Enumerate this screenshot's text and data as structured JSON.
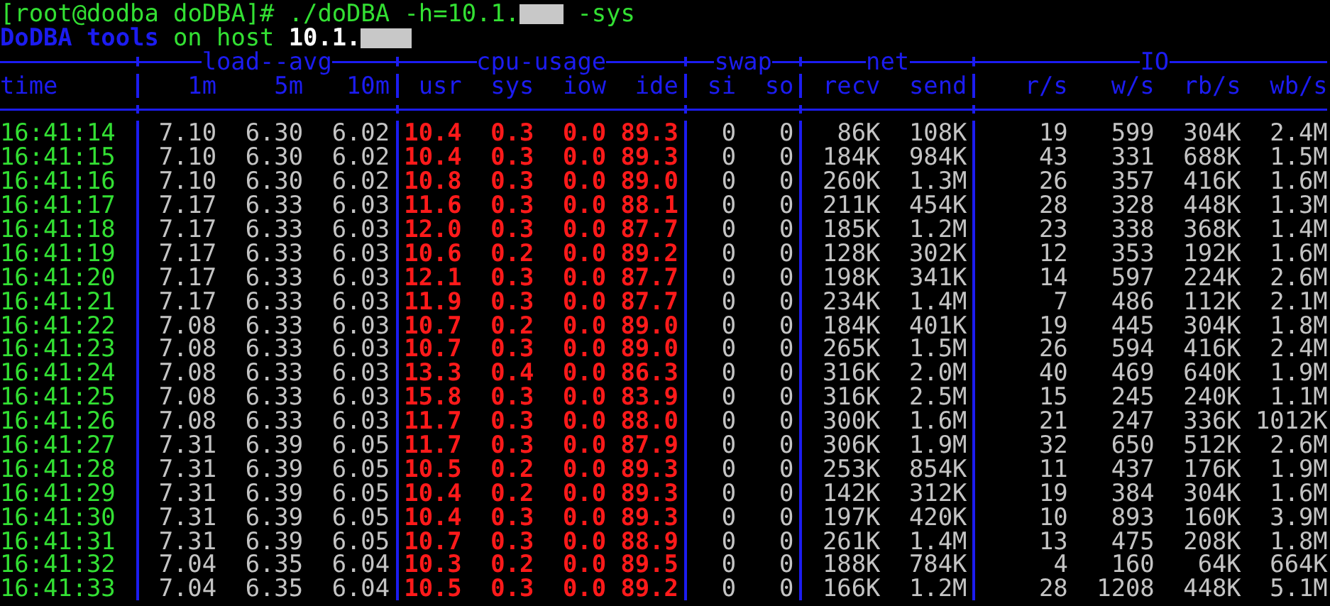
{
  "prompt_line": {
    "prompt": "[root@dodba doDBA]#",
    "command": "./doDBA -h=10.1.",
    "option": "-sys"
  },
  "banner": {
    "tool": "DoDBA tools",
    "text": "on host",
    "host": "10.1."
  },
  "groups": [
    {
      "title": "load--avg"
    },
    {
      "title": "cpu-usage"
    },
    {
      "title": "swap"
    },
    {
      "title": "net"
    },
    {
      "title": "IO"
    }
  ],
  "columns": [
    "time",
    "1m",
    "5m",
    "10m",
    "usr",
    "sys",
    "iow",
    "ide",
    "si",
    "so",
    "recv",
    "send",
    "r/s",
    "w/s",
    "rb/s",
    "wb/s"
  ],
  "rows": [
    {
      "time": "16:41:14",
      "values": [
        "7.10",
        "6.30",
        "6.02",
        "10.4",
        "0.3",
        "0.0",
        "89.3",
        "0",
        "0",
        "86K",
        "108K",
        "19",
        "599",
        "304K",
        "2.4M"
      ]
    },
    {
      "time": "16:41:15",
      "values": [
        "7.10",
        "6.30",
        "6.02",
        "10.4",
        "0.3",
        "0.0",
        "89.3",
        "0",
        "0",
        "184K",
        "984K",
        "43",
        "331",
        "688K",
        "1.5M"
      ]
    },
    {
      "time": "16:41:16",
      "values": [
        "7.10",
        "6.30",
        "6.02",
        "10.8",
        "0.3",
        "0.0",
        "89.0",
        "0",
        "0",
        "260K",
        "1.3M",
        "26",
        "357",
        "416K",
        "1.6M"
      ]
    },
    {
      "time": "16:41:17",
      "values": [
        "7.17",
        "6.33",
        "6.03",
        "11.6",
        "0.3",
        "0.0",
        "88.1",
        "0",
        "0",
        "211K",
        "454K",
        "28",
        "328",
        "448K",
        "1.3M"
      ]
    },
    {
      "time": "16:41:18",
      "values": [
        "7.17",
        "6.33",
        "6.03",
        "12.0",
        "0.3",
        "0.0",
        "87.7",
        "0",
        "0",
        "185K",
        "1.2M",
        "23",
        "338",
        "368K",
        "1.4M"
      ]
    },
    {
      "time": "16:41:19",
      "values": [
        "7.17",
        "6.33",
        "6.03",
        "10.6",
        "0.2",
        "0.0",
        "89.2",
        "0",
        "0",
        "128K",
        "302K",
        "12",
        "353",
        "192K",
        "1.6M"
      ]
    },
    {
      "time": "16:41:20",
      "values": [
        "7.17",
        "6.33",
        "6.03",
        "12.1",
        "0.3",
        "0.0",
        "87.7",
        "0",
        "0",
        "198K",
        "341K",
        "14",
        "597",
        "224K",
        "2.6M"
      ]
    },
    {
      "time": "16:41:21",
      "values": [
        "7.17",
        "6.33",
        "6.03",
        "11.9",
        "0.3",
        "0.0",
        "87.7",
        "0",
        "0",
        "234K",
        "1.4M",
        "7",
        "486",
        "112K",
        "2.1M"
      ]
    },
    {
      "time": "16:41:22",
      "values": [
        "7.08",
        "6.33",
        "6.03",
        "10.7",
        "0.2",
        "0.0",
        "89.0",
        "0",
        "0",
        "184K",
        "401K",
        "19",
        "445",
        "304K",
        "1.8M"
      ]
    },
    {
      "time": "16:41:23",
      "values": [
        "7.08",
        "6.33",
        "6.03",
        "10.7",
        "0.3",
        "0.0",
        "89.0",
        "0",
        "0",
        "265K",
        "1.5M",
        "26",
        "594",
        "416K",
        "2.4M"
      ]
    },
    {
      "time": "16:41:24",
      "values": [
        "7.08",
        "6.33",
        "6.03",
        "13.3",
        "0.4",
        "0.0",
        "86.3",
        "0",
        "0",
        "316K",
        "2.0M",
        "40",
        "469",
        "640K",
        "1.9M"
      ]
    },
    {
      "time": "16:41:25",
      "values": [
        "7.08",
        "6.33",
        "6.03",
        "15.8",
        "0.3",
        "0.0",
        "83.9",
        "0",
        "0",
        "316K",
        "2.5M",
        "15",
        "245",
        "240K",
        "1.1M"
      ]
    },
    {
      "time": "16:41:26",
      "values": [
        "7.08",
        "6.33",
        "6.03",
        "11.7",
        "0.3",
        "0.0",
        "88.0",
        "0",
        "0",
        "300K",
        "1.6M",
        "21",
        "247",
        "336K",
        "1012K"
      ]
    },
    {
      "time": "16:41:27",
      "values": [
        "7.31",
        "6.39",
        "6.05",
        "11.7",
        "0.3",
        "0.0",
        "87.9",
        "0",
        "0",
        "306K",
        "1.9M",
        "32",
        "650",
        "512K",
        "2.6M"
      ]
    },
    {
      "time": "16:41:28",
      "values": [
        "7.31",
        "6.39",
        "6.05",
        "10.5",
        "0.2",
        "0.0",
        "89.3",
        "0",
        "0",
        "253K",
        "854K",
        "11",
        "437",
        "176K",
        "1.9M"
      ]
    },
    {
      "time": "16:41:29",
      "values": [
        "7.31",
        "6.39",
        "6.05",
        "10.4",
        "0.2",
        "0.0",
        "89.3",
        "0",
        "0",
        "142K",
        "312K",
        "19",
        "384",
        "304K",
        "1.6M"
      ]
    },
    {
      "time": "16:41:30",
      "values": [
        "7.31",
        "6.39",
        "6.05",
        "10.4",
        "0.3",
        "0.0",
        "89.3",
        "0",
        "0",
        "197K",
        "420K",
        "10",
        "893",
        "160K",
        "3.9M"
      ]
    },
    {
      "time": "16:41:31",
      "values": [
        "7.31",
        "6.39",
        "6.05",
        "10.7",
        "0.3",
        "0.0",
        "88.9",
        "0",
        "0",
        "261K",
        "1.4M",
        "13",
        "475",
        "208K",
        "1.8M"
      ]
    },
    {
      "time": "16:41:32",
      "values": [
        "7.04",
        "6.35",
        "6.04",
        "10.3",
        "0.2",
        "0.0",
        "89.5",
        "0",
        "0",
        "188K",
        "784K",
        "4",
        "160",
        "64K",
        "664K"
      ]
    },
    {
      "time": "16:41:33",
      "values": [
        "7.04",
        "6.35",
        "6.04",
        "10.5",
        "0.3",
        "0.0",
        "89.2",
        "0",
        "0",
        "166K",
        "1.2M",
        "28",
        "1208",
        "448K",
        "5.1M"
      ]
    }
  ]
}
